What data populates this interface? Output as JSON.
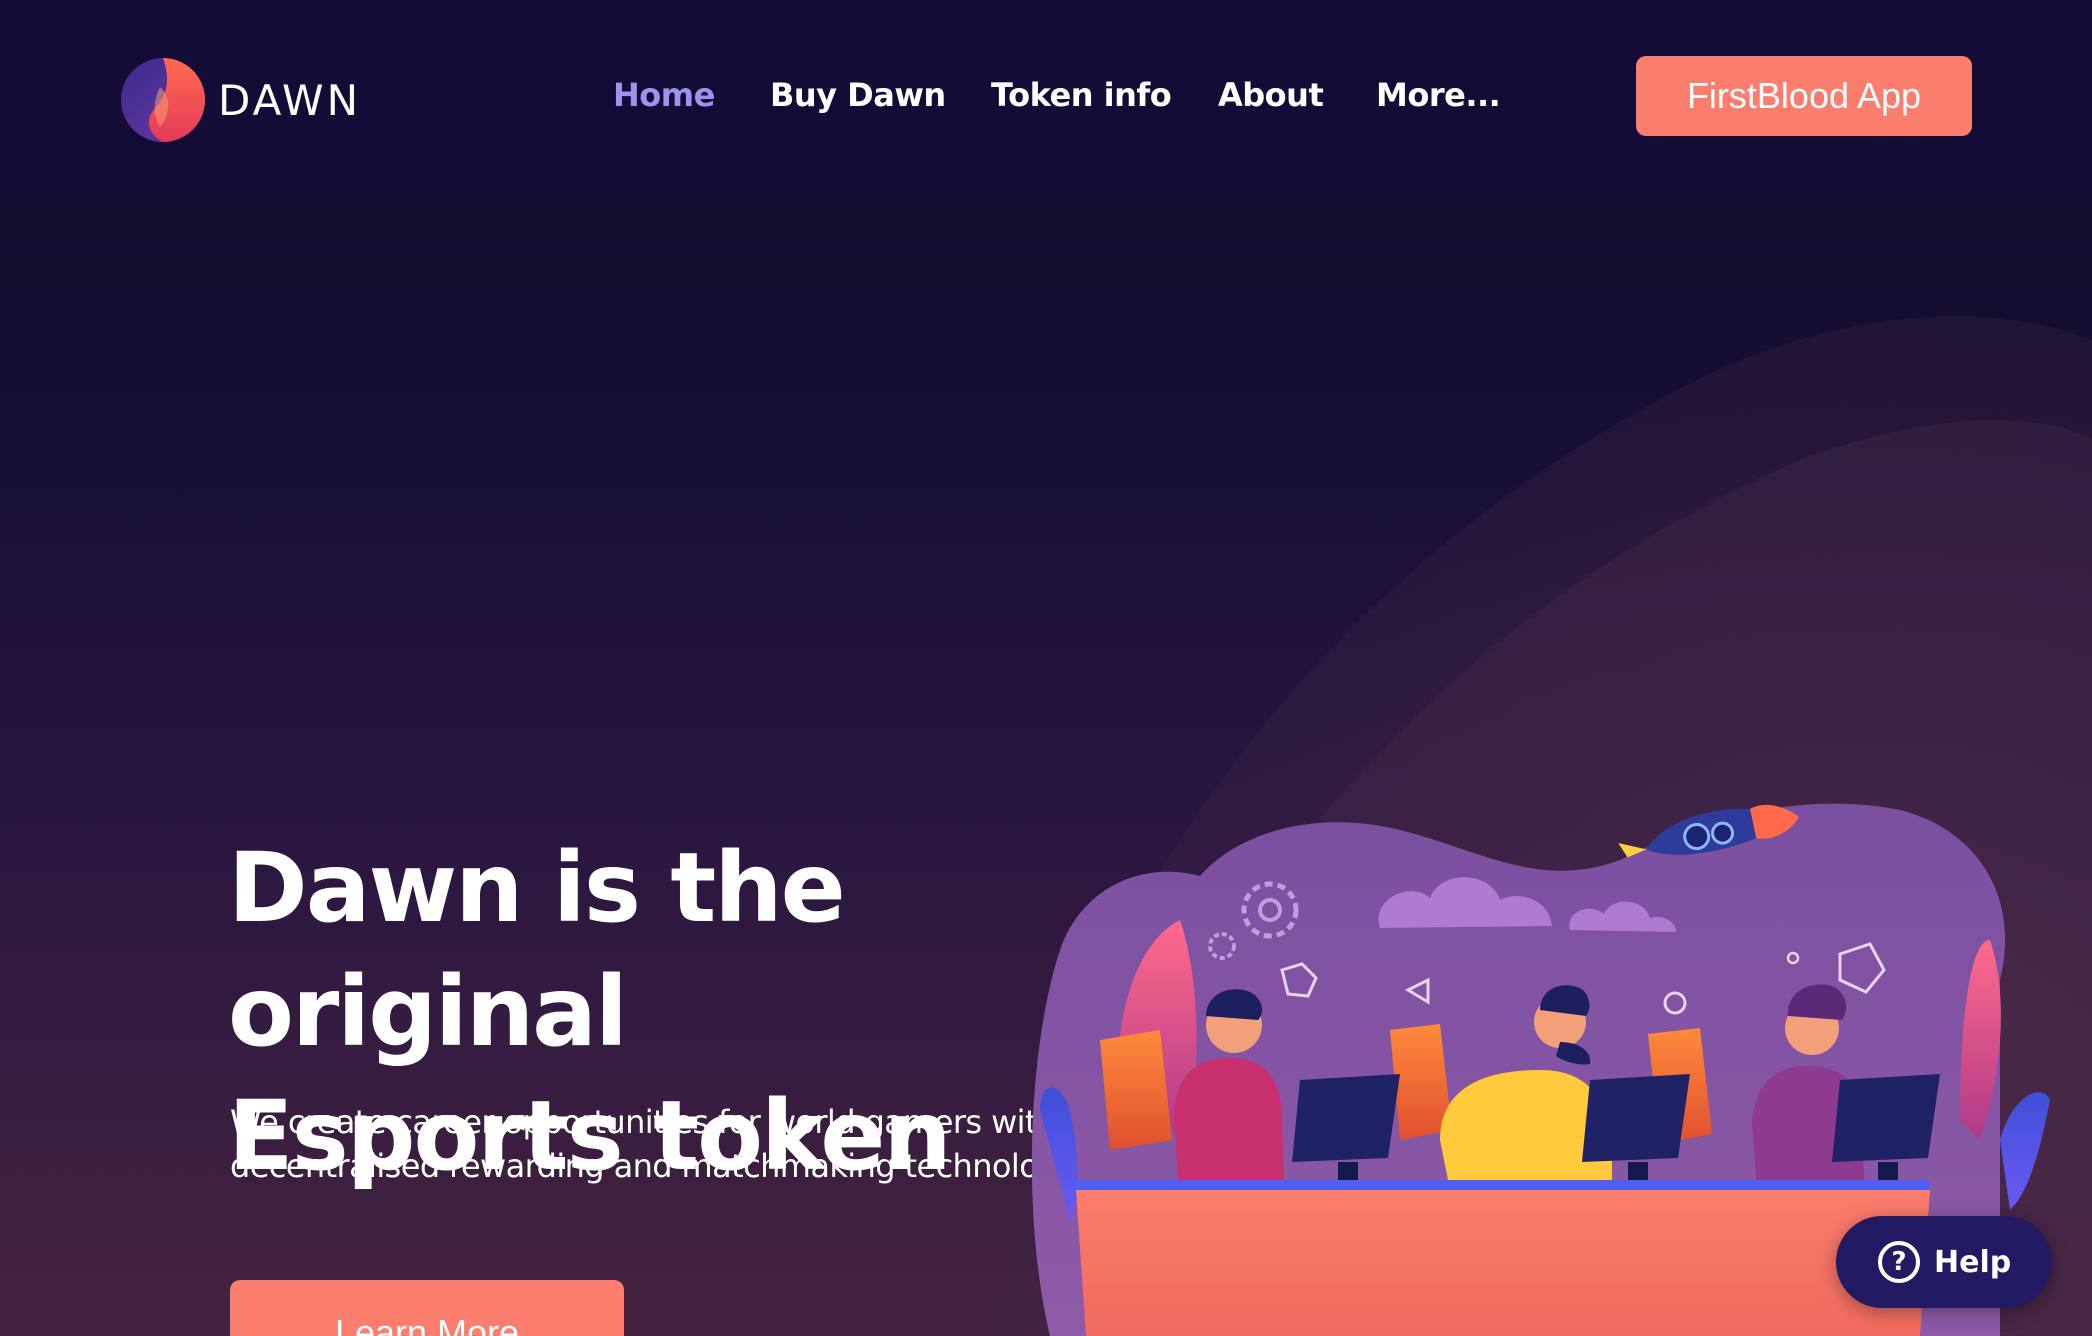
{
  "brand": {
    "name": "DAWN",
    "logo_icon": "dawn-flame-logo-icon"
  },
  "nav": {
    "items": [
      {
        "label": "Home",
        "active": true
      },
      {
        "label": "Buy Dawn",
        "active": false
      },
      {
        "label": "Token info",
        "active": false
      },
      {
        "label": "About",
        "active": false
      },
      {
        "label": "More...",
        "active": false
      }
    ]
  },
  "header_cta": {
    "label": "FirstBlood App"
  },
  "hero": {
    "title_lines": [
      "Dawn is the original",
      "Esports token"
    ],
    "subtitle_lines": [
      "We create career opportunities for world gamers with",
      "decentralised rewarding and matchmaking technologies"
    ],
    "cta_label": "Learn More",
    "illustration": "esports-gamers-illustration"
  },
  "help": {
    "label": "Help",
    "icon": "question-circle-icon"
  },
  "colors": {
    "header_bg": "#130c36",
    "accent": "#fb7d6d",
    "nav_active": "#9d93ef",
    "help_bg": "#221a63"
  }
}
